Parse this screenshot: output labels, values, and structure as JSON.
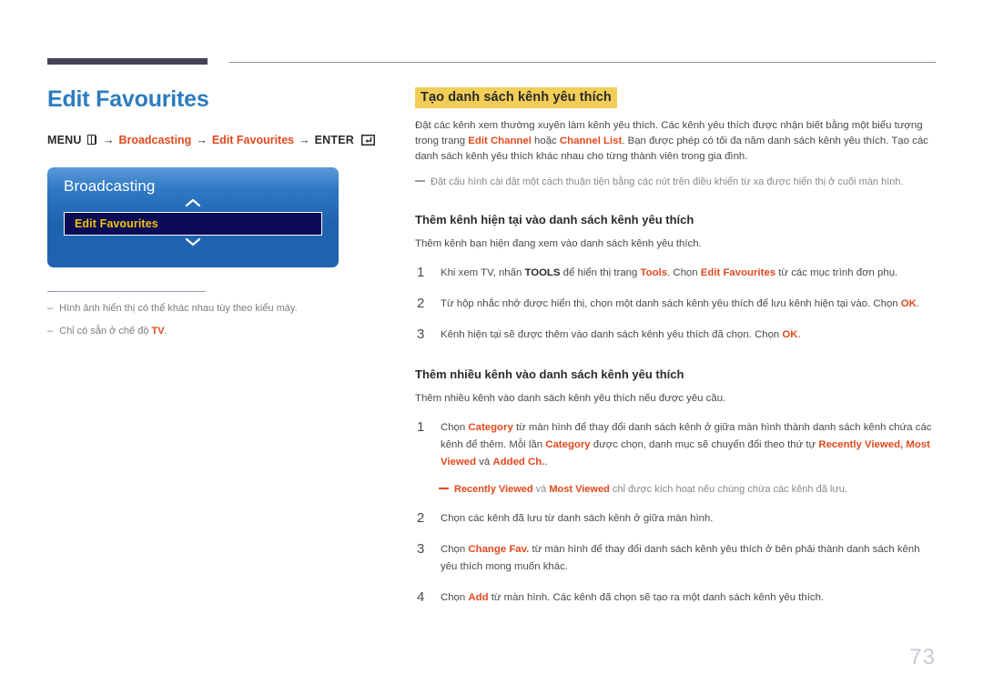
{
  "header": {
    "rule_color": "#474159",
    "thin_rule_color": "#8a8a92"
  },
  "left": {
    "page_title": "Edit Favourites",
    "breadcrumb": {
      "menu_label": "MENU",
      "menu_icon": "menu-grid-icon",
      "arrow": "→",
      "item1": "Broadcasting",
      "item2": "Edit Favourites",
      "enter_label": "ENTER",
      "enter_icon": "enter-key-icon"
    },
    "tv_panel": {
      "title": "Broadcasting",
      "up_icon": "chevron-up-icon",
      "down_icon": "chevron-down-icon",
      "selected_item": "Edit Favourites",
      "accent_text_color": "#f4c20d",
      "panel_color": "#1f62b0"
    },
    "footnotes": [
      {
        "dash": "–",
        "text": "Hình ảnh hiển thị có thể khác nhau tùy theo kiểu máy.",
        "hot": "",
        "tail": ""
      },
      {
        "dash": "–",
        "text": "Chỉ có sẵn ở chế độ ",
        "hot": "TV",
        "tail": "."
      }
    ]
  },
  "right": {
    "section_title": "Tạo danh sách kênh yêu thích",
    "intro": {
      "part1": "Đặt các kênh xem thường xuyên làm kênh yêu thích. Các kênh yêu thích được nhận biết bằng một biểu tượng trong trang ",
      "hot1": "Edit Channel",
      "part2": " hoặc ",
      "hot2": "Channel List",
      "part3": ". Bạn được phép có tối đa năm danh sách kênh yêu thích. Tạo các danh sách kênh yêu thích khác nhau cho từng thành viên trong gia đình."
    },
    "intro_note": "Đặt cấu hình cài đặt một cách thuận tiện bằng các nút trên điều khiển từ xa được hiển thị ở cuối màn hình.",
    "section1": {
      "heading": "Thêm kênh hiện tại vào danh sách kênh yêu thích",
      "lead": "Thêm kênh bạn hiện đang xem vào danh sách kênh yêu thích.",
      "steps": [
        {
          "num": "1",
          "seg": [
            {
              "t": "Khi xem TV, nhấn ",
              "s": "n"
            },
            {
              "t": "TOOLS",
              "s": "b"
            },
            {
              "t": " để hiển thị trang ",
              "s": "n"
            },
            {
              "t": "Tools",
              "s": "h"
            },
            {
              "t": ". Chọn ",
              "s": "n"
            },
            {
              "t": "Edit Favourites",
              "s": "h"
            },
            {
              "t": " từ các mục trình đơn phụ.",
              "s": "n"
            }
          ]
        },
        {
          "num": "2",
          "seg": [
            {
              "t": "Từ hộp nhắc nhở được hiển thị, chọn một danh sách kênh yêu thích để lưu kênh hiện tại vào. Chọn ",
              "s": "n"
            },
            {
              "t": "OK",
              "s": "h"
            },
            {
              "t": ".",
              "s": "n"
            }
          ]
        },
        {
          "num": "3",
          "seg": [
            {
              "t": "Kênh hiện tại sẽ được thêm vào danh sách kênh yêu thích đã chọn. Chọn ",
              "s": "n"
            },
            {
              "t": "OK",
              "s": "h"
            },
            {
              "t": ".",
              "s": "n"
            }
          ]
        }
      ]
    },
    "section2": {
      "heading": "Thêm nhiều kênh vào danh sách kênh yêu thích",
      "lead": "Thêm nhiều kênh vào danh sách kênh yêu thích nếu được yêu cầu.",
      "steps": [
        {
          "num": "1",
          "seg": [
            {
              "t": "Chọn ",
              "s": "n"
            },
            {
              "t": "Category",
              "s": "h"
            },
            {
              "t": " từ màn hình để thay đổi danh sách kênh ở giữa màn hình thành danh sách kênh chứa các kênh để thêm. Mỗi lần ",
              "s": "n"
            },
            {
              "t": "Category",
              "s": "h"
            },
            {
              "t": " được chọn, danh mục sẽ chuyển đổi theo thứ tự ",
              "s": "n"
            },
            {
              "t": "Recently Viewed, Most Viewed",
              "s": "h"
            },
            {
              "t": " và ",
              "s": "n"
            },
            {
              "t": "Added Ch.",
              "s": "h"
            },
            {
              "t": ".",
              "s": "n"
            }
          ],
          "note": [
            {
              "t": "Recently Viewed",
              "s": "h"
            },
            {
              "t": " và ",
              "s": "g"
            },
            {
              "t": "Most Viewed",
              "s": "h"
            },
            {
              "t": " chỉ được kích hoạt nếu chúng chứa các kênh đã lưu.",
              "s": "g"
            }
          ]
        },
        {
          "num": "2",
          "seg": [
            {
              "t": "Chọn các kênh đã lưu từ danh sách kênh ở giữa màn hình.",
              "s": "n"
            }
          ]
        },
        {
          "num": "3",
          "seg": [
            {
              "t": "Chọn ",
              "s": "n"
            },
            {
              "t": "Change Fav.",
              "s": "h"
            },
            {
              "t": " từ màn hình để thay đổi danh sách kênh yêu thích ở bên phải thành danh sách kênh yêu thích mong muốn khác.",
              "s": "n"
            }
          ]
        },
        {
          "num": "4",
          "seg": [
            {
              "t": "Chọn ",
              "s": "n"
            },
            {
              "t": "Add",
              "s": "h"
            },
            {
              "t": " từ màn hình. Các kênh đã chọn sẽ tạo ra một danh sách kênh yêu thích.",
              "s": "n"
            }
          ]
        }
      ]
    }
  },
  "footer": {
    "page_number": "73"
  },
  "colors": {
    "accent_blue": "#2d7cc0",
    "accent_orange": "#e1491c",
    "highlight_yellow": "#f2ce58",
    "panel_navy": "#0a0a55"
  }
}
